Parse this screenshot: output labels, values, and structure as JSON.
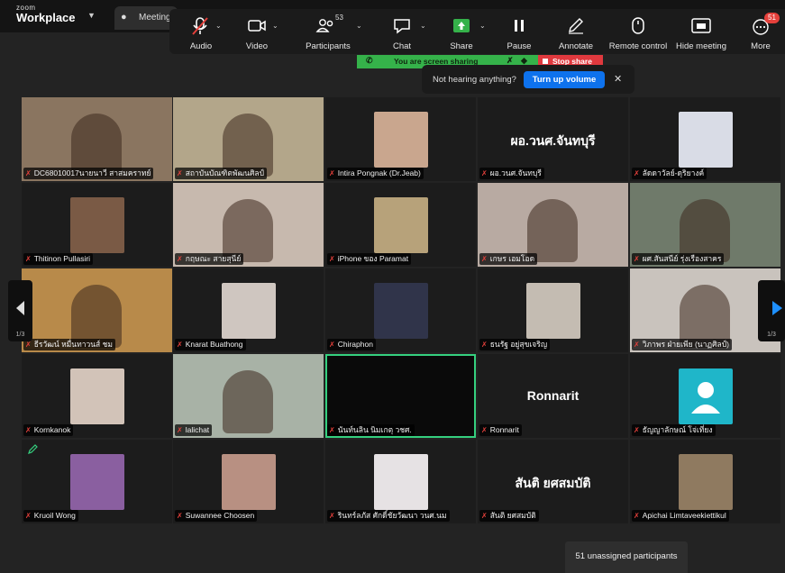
{
  "app": {
    "logo_small": "zoom",
    "logo_big": "Workplace",
    "meeting_tab": "Meeting"
  },
  "toolbar": {
    "audio": "Audio",
    "video": "Video",
    "participants": "Participants",
    "participants_count": "53",
    "chat": "Chat",
    "share": "Share",
    "pause": "Pause",
    "annotate": "Annotate",
    "remote_control": "Remote control",
    "hide_meeting": "Hide meeting",
    "more": "More",
    "more_badge": "51"
  },
  "sharing": {
    "status": "You are screen sharing",
    "stop": "Stop share"
  },
  "volume_toast": {
    "question": "Not hearing anything?",
    "button": "Turn up volume"
  },
  "pager": {
    "left": "1/3",
    "right": "1/3"
  },
  "tiles": [
    {
      "name": "DC68010017นายนาวี สาสมคราทย์",
      "type": "video",
      "bg": "#8a7560"
    },
    {
      "name": "สถาบันบัณฑิตพัฒนศิลป์",
      "type": "video",
      "bg": "#b3a68a"
    },
    {
      "name": "Intira Pongnak (Dr.Jeab)",
      "type": "photo",
      "bg": "#1c1c1c",
      "thumb": "#c9a68e"
    },
    {
      "name": "ผอ.วนศ.จันทบุรี",
      "type": "text",
      "big": "ผอ.วนศ.จันทบุรี"
    },
    {
      "name": "ลัดดาวัลย์-ดุริยางค์",
      "type": "photo",
      "bg": "#1c1c1c",
      "thumb": "#d9dce6"
    },
    {
      "name": "Thitinon Pullasiri",
      "type": "photo",
      "bg": "#1c1c1c",
      "thumb": "#7a5a45"
    },
    {
      "name": "กฤษณะ สายสุนีย์",
      "type": "video",
      "bg": "#c7b9ae"
    },
    {
      "name": "iPhone ของ Paramat",
      "type": "photo",
      "bg": "#1c1c1c",
      "thumb": "#b7a27a"
    },
    {
      "name": "เกษร เอมโอด",
      "type": "video",
      "bg": "#b8aaa2"
    },
    {
      "name": "ผศ.สันสนีย์ รุ่งเรืองสาคร",
      "type": "video",
      "bg": "#6f7a6a"
    },
    {
      "name": "ธีรวัฒน์ หมื่นทาวนส์ ชม",
      "type": "video",
      "bg": "#b88a4a"
    },
    {
      "name": "Knarat Buathong",
      "type": "photo",
      "bg": "#1c1c1c",
      "thumb": "#cfc6c0"
    },
    {
      "name": "Chiraphon",
      "type": "photo",
      "bg": "#1c1c1c",
      "thumb": "#30344a"
    },
    {
      "name": "ธนรัฐ อยู่สุขเจริญ",
      "type": "photo",
      "bg": "#1c1c1c",
      "thumb": "#c4bcb2"
    },
    {
      "name": "วิภาพร ฝ่ายเพีย (นาฏศิลป์)",
      "type": "video",
      "bg": "#c9c3bd"
    },
    {
      "name": "Kornkanok",
      "type": "photo",
      "bg": "#1c1c1c",
      "thumb": "#d2c3b8"
    },
    {
      "name": "lalichat",
      "type": "video",
      "bg": "#a8b2a6"
    },
    {
      "name": "นันท์นลิน นิมเกตุ วชศ.",
      "type": "blank",
      "bg": "#0a0a0a"
    },
    {
      "name": "Ronnarit",
      "type": "text",
      "big": "Ronnarit"
    },
    {
      "name": "ธัญญาลักษณ์ โจ่เที่ยง",
      "type": "avatar",
      "bg": "#1c1c1c",
      "thumb": "#1fb6c9"
    },
    {
      "name": "Kruoil Wong",
      "type": "photo",
      "bg": "#1c1c1c",
      "thumb": "#8a5fa0"
    },
    {
      "name": "Suwannee Choosen",
      "type": "photo",
      "bg": "#1c1c1c",
      "thumb": "#b89082"
    },
    {
      "name": "รินทร์ลภัส ศักดิ์ชัยวัฒนา วนศ.นม",
      "type": "photo",
      "bg": "#1c1c1c",
      "thumb": "#e6e2e4"
    },
    {
      "name": "สันติ ยศสมบัติ",
      "type": "text",
      "big": "สันติ ยศสมบัติ"
    },
    {
      "name": "Apichai Limtaveekiettikul",
      "type": "photo",
      "bg": "#1c1c1c",
      "thumb": "#8f7a60"
    }
  ],
  "unassigned": "51 unassigned participants"
}
